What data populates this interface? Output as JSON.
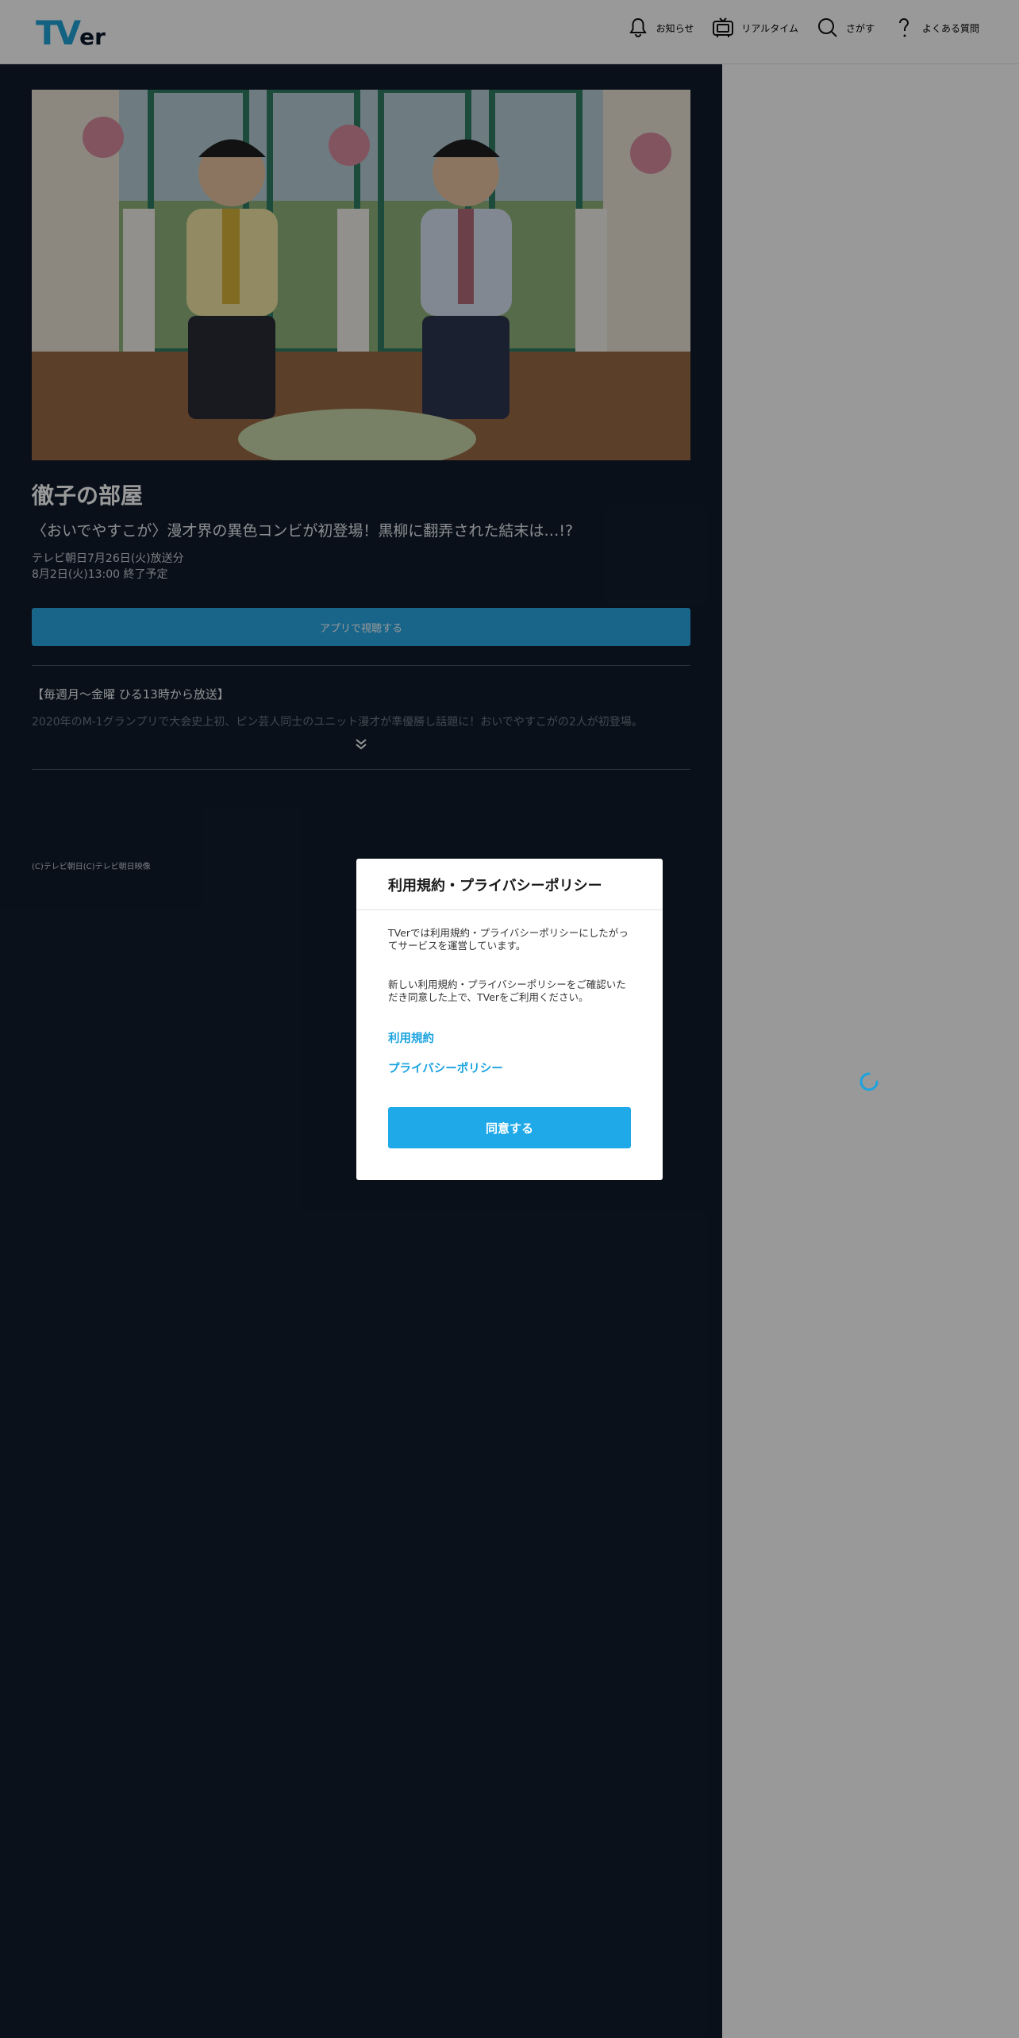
{
  "header": {
    "logo_text_t": "T",
    "logo_text_v": "V",
    "logo_text_er": "er",
    "nav": [
      {
        "label": "お知らせ",
        "icon": "bell-icon"
      },
      {
        "label": "リアルタイム",
        "icon": "tv-icon"
      },
      {
        "label": "さがす",
        "icon": "search-icon"
      },
      {
        "label": "よくある質問",
        "icon": "question-icon"
      }
    ]
  },
  "episode": {
    "title": "徹子の部屋",
    "subtitle": "〈おいでやすこが〉漫才界の異色コンビが初登場！黒柳に翻弄された結末は…!?",
    "broadcast": "テレビ朝日7月26日(火)放送分",
    "expires": "8月2日(火)13:00 終了予定",
    "app_button": "アプリで視聴する",
    "schedule": "【毎週月～金曜 ひる13時から放送】",
    "description": "2020年のM-1グランプリで大会史上初、ピン芸人同士のユニット漫才が準優勝し話題に！おいでやすこがの2人が初登場。",
    "copyright": "(C)テレビ朝日(C)テレビ朝日映像"
  },
  "modal": {
    "title": "利用規約・プライバシーポリシー",
    "paragraph1": "TVerでは利用規約・プライバシーポリシーにしたがってサービスを運営しています。",
    "paragraph2": "新しい利用規約・プライバシーポリシーをご確認いただき同意した上で、TVerをご利用ください。",
    "link_terms": "利用規約",
    "link_privacy": "プライバシーポリシー",
    "agree_button": "同意する"
  },
  "colors": {
    "brand": "#21a3d8",
    "panel": "#101c2c",
    "button": "#20a9e8"
  }
}
